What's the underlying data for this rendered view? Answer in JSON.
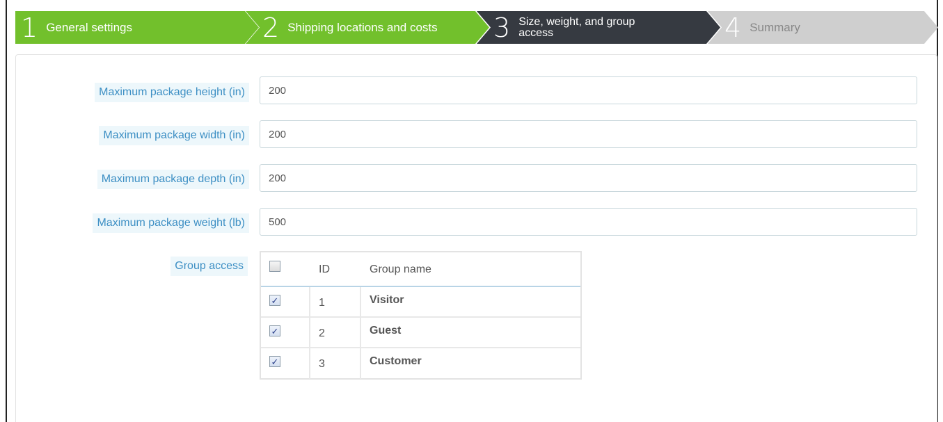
{
  "wizard": {
    "steps": [
      {
        "number": "1",
        "label": "General settings",
        "state": "done",
        "color": "#72c02c"
      },
      {
        "number": "2",
        "label": "Shipping locations and costs",
        "state": "done",
        "color": "#72c02c"
      },
      {
        "number": "3",
        "label": "Size, weight, and group access",
        "state": "active",
        "color": "#363a41"
      },
      {
        "number": "4",
        "label": "Summary",
        "state": "todo",
        "color": "#cfcfcf"
      }
    ]
  },
  "form": {
    "height": {
      "label": "Maximum package height (in)",
      "value": "200"
    },
    "width": {
      "label": "Maximum package width (in)",
      "value": "200"
    },
    "depth": {
      "label": "Maximum package depth (in)",
      "value": "200"
    },
    "weight": {
      "label": "Maximum package weight (lb)",
      "value": "500"
    },
    "group_access": {
      "label": "Group access",
      "columns": [
        "ID",
        "Group name"
      ],
      "select_all_checked": false,
      "rows": [
        {
          "checked": true,
          "id": "1",
          "name": "Visitor"
        },
        {
          "checked": true,
          "id": "2",
          "name": "Guest"
        },
        {
          "checked": true,
          "id": "3",
          "name": "Customer"
        }
      ]
    }
  },
  "colors": {
    "step_done": "#72c02c",
    "step_active": "#363a41",
    "step_todo": "#cfcfcf",
    "label_bg": "#edf7fb",
    "label_text": "#3d8fc4"
  }
}
